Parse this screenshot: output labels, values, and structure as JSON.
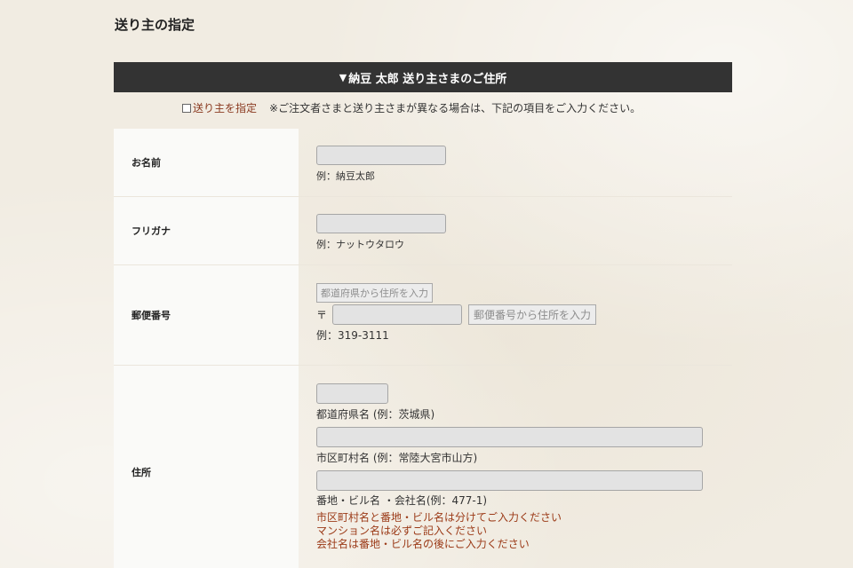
{
  "page": {
    "heading": "送り主の指定",
    "bar_title": "納豆 太郎 送り主さまのご住所",
    "bar_marker": "▼"
  },
  "notice": {
    "checkbox_label": "送り主を指定",
    "message": "※ご注文者さまと送り主さまが異なる場合は、下記の項目をご入力ください。"
  },
  "form": {
    "name": {
      "label": "お名前",
      "value": "",
      "example": "例：納豆太郎"
    },
    "kana": {
      "label": "フリガナ",
      "value": "",
      "example": "例：ナットウタロウ"
    },
    "postal": {
      "label": "郵便番号",
      "pref_button": "都道府県から住所を入力",
      "prefix": "〒",
      "value": "",
      "lookup_button": "郵便番号から住所を入力",
      "example": "例：319-3111"
    },
    "address": {
      "label": "住所",
      "pref_value": "",
      "pref_hint": "都道府県名 (例：茨城県)",
      "city_value": "",
      "city_hint": "市区町村名 (例：常陸大宮市山方)",
      "street_value": "",
      "street_hint": "番地・ビル名 ・会社名(例：477-1)",
      "notes": [
        "市区町村名と番地・ビル名は分けてご入力ください",
        "マンション名は必ずご記入ください",
        "会社名は番地・ビル名の後にご入力ください"
      ]
    }
  }
}
